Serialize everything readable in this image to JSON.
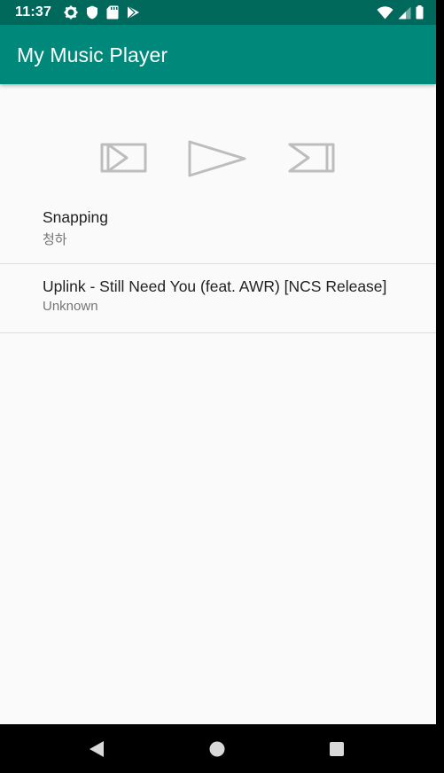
{
  "status_bar": {
    "time": "11:37",
    "left_icons": [
      "settings-icon",
      "shield-icon",
      "sd-card-icon",
      "play-store-icon"
    ],
    "right_icons": [
      "wifi-icon",
      "signal-icon",
      "battery-icon"
    ]
  },
  "app_bar": {
    "title": "My Music Player",
    "background": "#00897b",
    "status_background": "#00695c"
  },
  "controls": {
    "prev_icon": "skip-previous-icon",
    "play_icon": "play-icon",
    "next_icon": "skip-next-icon",
    "icon_color": "#bdbdbd"
  },
  "songs": [
    {
      "title": "Snapping",
      "artist": "청하"
    },
    {
      "title": "Uplink - Still Need You (feat. AWR) [NCS Release]",
      "artist": "Unknown"
    }
  ],
  "nav_bar": {
    "back_icon": "back-triangle-icon",
    "home_icon": "home-circle-icon",
    "recent_icon": "recents-square-icon"
  }
}
